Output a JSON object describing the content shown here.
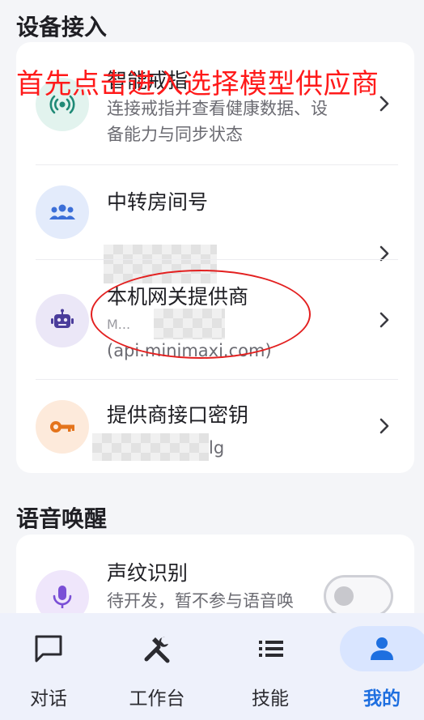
{
  "sections": {
    "device": "设备接入",
    "voice": "语音唤醒"
  },
  "annotation": "首先点击进入选择模型供应商",
  "rows": {
    "ring": {
      "title": "智能戒指",
      "subtitle_line1": "连接戒指并查看健康数据、设",
      "subtitle_line2": "备能力与同步状态"
    },
    "relay": {
      "title": "中转房间号"
    },
    "gateway": {
      "title": "本机网关提供商",
      "subtitle_prefix": "M...",
      "subtitle_host": "(api.minimaxi.com)"
    },
    "apikey": {
      "title": "提供商接口密钥",
      "subtitle_suffix": "lg"
    },
    "voiceprint": {
      "title": "声纹识别",
      "subtitle": "待开发，暂不参与语音唤",
      "toggle_on": false
    }
  },
  "nav": {
    "items": [
      {
        "label": "对话",
        "icon": "chat-bubble-icon",
        "active": false
      },
      {
        "label": "工作台",
        "icon": "tools-icon",
        "active": false
      },
      {
        "label": "技能",
        "icon": "list-icon",
        "active": false
      },
      {
        "label": "我的",
        "icon": "person-icon",
        "active": true
      }
    ]
  },
  "colors": {
    "accent": "#1e6fe0",
    "annotation": "#ff1a1a",
    "ring_icon": "#1f8a76",
    "relay_icon": "#3c6fd8",
    "gateway_icon": "#4a3c9b",
    "key_icon": "#e4741c",
    "mic_icon": "#7a4fd6"
  }
}
